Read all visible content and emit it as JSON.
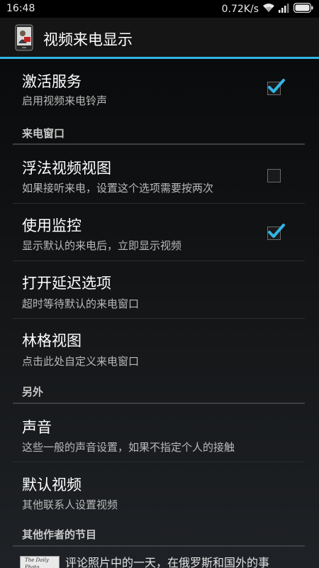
{
  "status_bar": {
    "time": "16:48",
    "speed": "0.72K/s"
  },
  "action_bar": {
    "title": "视频来电显示",
    "accent_color": "#33b5e5"
  },
  "sections": {
    "main": {
      "item_activate": {
        "title": "激活服务",
        "summary": "启用视频来电铃声",
        "checked": true
      }
    },
    "incoming_window": {
      "header": "来电窗口",
      "item_float": {
        "title": "浮法视频视图",
        "summary": "如果接听来电，设置这个选项需要按两次",
        "checked": false
      },
      "item_monitor": {
        "title": "使用监控",
        "summary": "显示默认的来电后，立即显示视频",
        "checked": true
      },
      "item_delay": {
        "title": "打开延迟选项",
        "summary": "超时等待默认的来电窗口"
      },
      "item_lingge": {
        "title": "林格视图",
        "summary": "点击此处自定义来电窗口"
      }
    },
    "other": {
      "header": "另外",
      "item_sound": {
        "title": "声音",
        "summary": "这些一般的声音设置，如果不指定个人的接触"
      },
      "item_default_video": {
        "title": "默认视频",
        "summary": "其他联系人设置视频"
      }
    },
    "more_apps": {
      "header": "其他作者的节目",
      "ad_thumb_label": "The Daily Photo",
      "ad_text": "评论照片中的一天，在俄罗斯和国外的事"
    }
  }
}
